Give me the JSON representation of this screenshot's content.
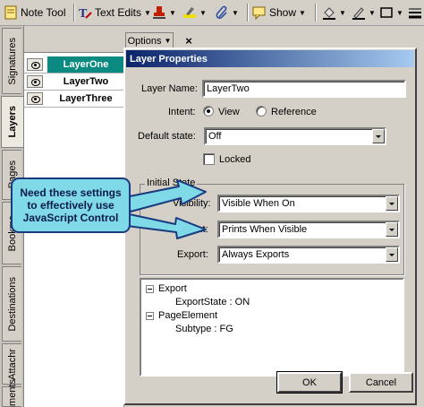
{
  "toolbar": {
    "note_tool": "Note Tool",
    "text_edits": "Text Edits",
    "show": "Show"
  },
  "side_tabs": [
    "Signatures",
    "Layers",
    "Pages",
    "Bookmarks",
    "Destinations",
    "Attachments",
    "Comments"
  ],
  "side_tabs_visible": {
    "signatures": "Signatures",
    "layers": "Layers",
    "pages": "Pages",
    "bookmarks": "Bookma",
    "destinations": "Destinations",
    "attachments": "Attachr",
    "comments": "mments"
  },
  "layers": [
    {
      "name": "LayerOne",
      "selected": true
    },
    {
      "name": "LayerTwo",
      "selected": false
    },
    {
      "name": "LayerThree",
      "selected": false
    }
  ],
  "options_label": "Options",
  "close_label": "×",
  "dialog": {
    "title": "Layer Properties",
    "layer_name_label": "Layer Name:",
    "layer_name_value": "LayerTwo",
    "intent_label": "Intent:",
    "intent_view": "View",
    "intent_reference": "Reference",
    "intent_selected": "View",
    "default_state_label": "Default state:",
    "default_state_value": "Off",
    "locked_label": "Locked",
    "locked_checked": false,
    "initial_state_title": "Initial State",
    "visibility_label": "Visibility:",
    "visibility_value": "Visible When On",
    "print_label": "Print:",
    "print_value": "Prints When Visible",
    "export_label": "Export:",
    "export_value": "Always Exports",
    "tree": {
      "export_node": "Export",
      "export_state": "ExportState : ON",
      "page_element_node": "PageElement",
      "subtype": "Subtype : FG"
    },
    "ok_label": "OK",
    "cancel_label": "Cancel"
  },
  "callout_text": "Need these settings to effectively use JavaScript Control",
  "colors": {
    "selected_layer": "#0a8a80",
    "callout_fill": "#7fd9e6",
    "callout_border": "#1a3a80",
    "titlebar": "#0a246a"
  }
}
